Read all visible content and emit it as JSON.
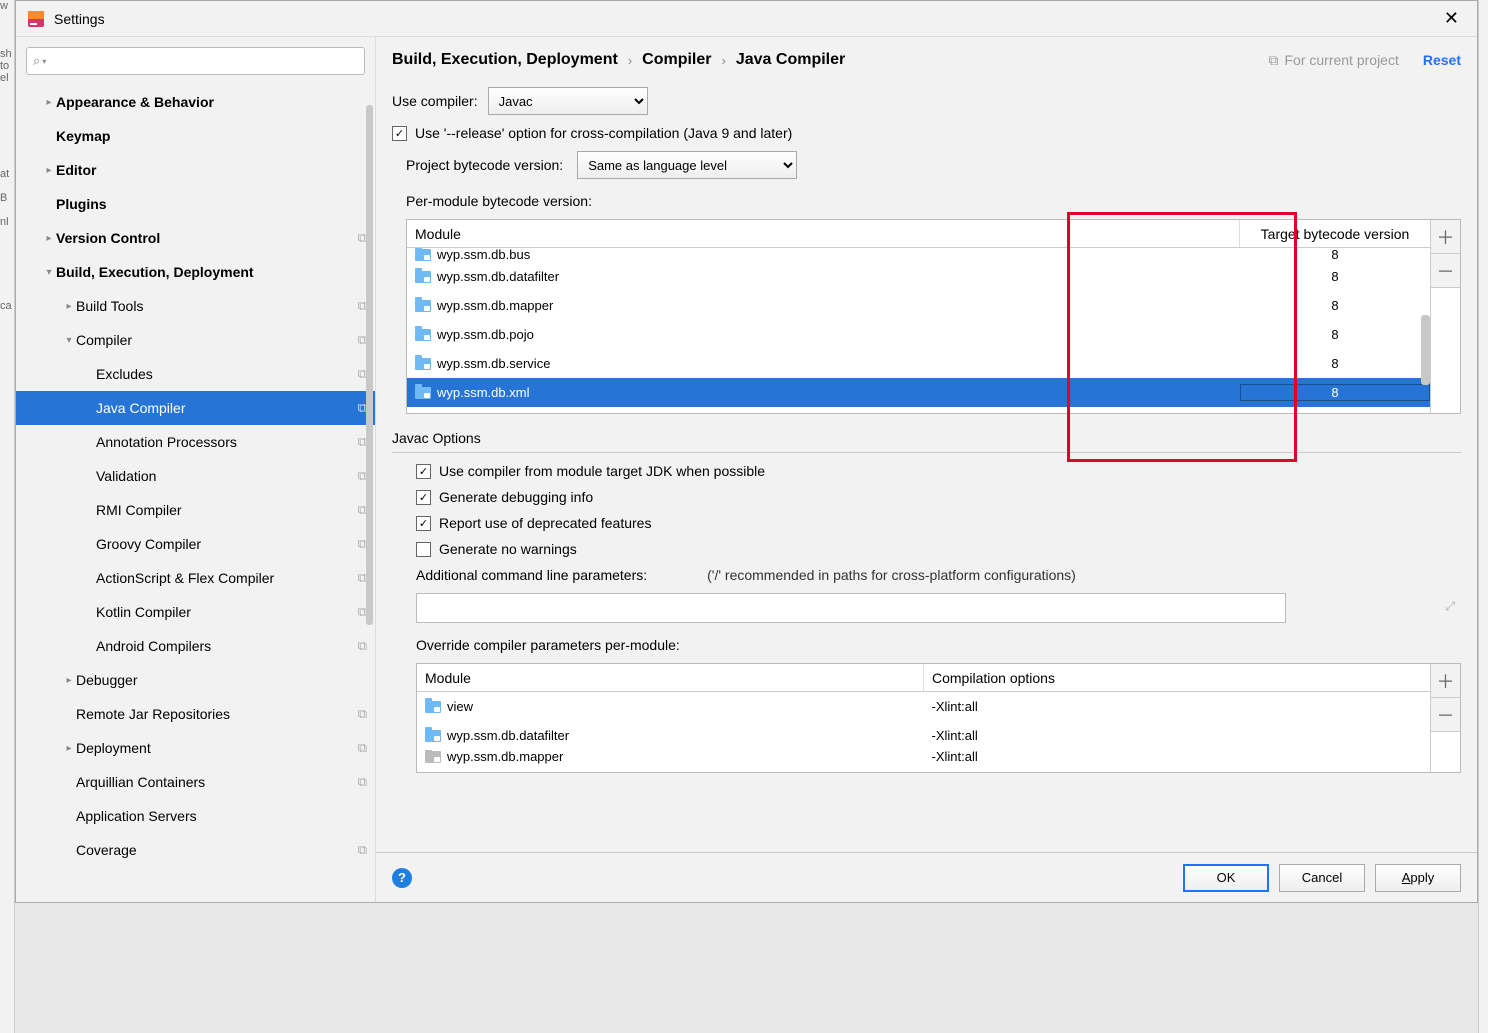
{
  "window": {
    "title": "Settings"
  },
  "sidebar": {
    "items": [
      {
        "label": "Appearance & Behavior",
        "arrow": "closed",
        "bold": true,
        "indent": 0
      },
      {
        "label": "Keymap",
        "arrow": "none",
        "bold": true,
        "indent": 0
      },
      {
        "label": "Editor",
        "arrow": "closed",
        "bold": true,
        "indent": 0
      },
      {
        "label": "Plugins",
        "arrow": "none",
        "bold": true,
        "indent": 0
      },
      {
        "label": "Version Control",
        "arrow": "closed",
        "bold": true,
        "indent": 0,
        "badge": true
      },
      {
        "label": "Build, Execution, Deployment",
        "arrow": "open",
        "bold": true,
        "indent": 0
      },
      {
        "label": "Build Tools",
        "arrow": "closed",
        "bold": false,
        "indent": 1,
        "badge": true
      },
      {
        "label": "Compiler",
        "arrow": "open",
        "bold": false,
        "indent": 1,
        "badge": true
      },
      {
        "label": "Excludes",
        "arrow": "none",
        "bold": false,
        "indent": 2,
        "badge": true
      },
      {
        "label": "Java Compiler",
        "arrow": "none",
        "bold": false,
        "indent": 2,
        "badge": true,
        "selected": true
      },
      {
        "label": "Annotation Processors",
        "arrow": "none",
        "bold": false,
        "indent": 2,
        "badge": true
      },
      {
        "label": "Validation",
        "arrow": "none",
        "bold": false,
        "indent": 2,
        "badge": true
      },
      {
        "label": "RMI Compiler",
        "arrow": "none",
        "bold": false,
        "indent": 2,
        "badge": true
      },
      {
        "label": "Groovy Compiler",
        "arrow": "none",
        "bold": false,
        "indent": 2,
        "badge": true
      },
      {
        "label": "ActionScript & Flex Compiler",
        "arrow": "none",
        "bold": false,
        "indent": 2,
        "badge": true
      },
      {
        "label": "Kotlin Compiler",
        "arrow": "none",
        "bold": false,
        "indent": 2,
        "badge": true
      },
      {
        "label": "Android Compilers",
        "arrow": "none",
        "bold": false,
        "indent": 2,
        "badge": true
      },
      {
        "label": "Debugger",
        "arrow": "closed",
        "bold": false,
        "indent": 1
      },
      {
        "label": "Remote Jar Repositories",
        "arrow": "none",
        "bold": false,
        "indent": 1,
        "badge": true
      },
      {
        "label": "Deployment",
        "arrow": "closed",
        "bold": false,
        "indent": 1,
        "badge": true
      },
      {
        "label": "Arquillian Containers",
        "arrow": "none",
        "bold": false,
        "indent": 1,
        "badge": true
      },
      {
        "label": "Application Servers",
        "arrow": "none",
        "bold": false,
        "indent": 1
      },
      {
        "label": "Coverage",
        "arrow": "none",
        "bold": false,
        "indent": 1,
        "badge": true
      }
    ]
  },
  "breadcrumb": [
    "Build, Execution, Deployment",
    "Compiler",
    "Java Compiler"
  ],
  "header": {
    "forProject": "For current project",
    "reset": "Reset"
  },
  "main": {
    "useCompilerLabel": "Use compiler:",
    "useCompilerValue": "Javac",
    "releaseOption": "Use '--release' option for cross-compilation (Java 9 and later)",
    "projectBytecodeLabel": "Project bytecode version:",
    "projectBytecodeValue": "Same as language level",
    "perModuleLabel": "Per-module bytecode version:",
    "moduleHeader": "Module",
    "targetHeader": "Target bytecode version",
    "modules": [
      {
        "name": "wyp.ssm.db.bus",
        "ver": "8",
        "cutoff": true
      },
      {
        "name": "wyp.ssm.db.datafilter",
        "ver": "8"
      },
      {
        "name": "wyp.ssm.db.mapper",
        "ver": "8"
      },
      {
        "name": "wyp.ssm.db.pojo",
        "ver": "8"
      },
      {
        "name": "wyp.ssm.db.service",
        "ver": "8"
      },
      {
        "name": "wyp.ssm.db.xml",
        "ver": "8",
        "selected": true
      }
    ],
    "javacOptionsTitle": "Javac Options",
    "opt1": "Use compiler from module target JDK when possible",
    "opt2": "Generate debugging info",
    "opt3": "Report use of deprecated features",
    "opt4": "Generate no warnings",
    "addlLabel": "Additional command line parameters:",
    "addlHint": "('/' recommended in paths for cross-platform configurations)",
    "overrideLabel": "Override compiler parameters per-module:",
    "overrideHeaderModule": "Module",
    "overrideHeaderOptions": "Compilation options",
    "overrides": [
      {
        "module": "view",
        "opts": "-Xlint:all"
      },
      {
        "module": "wyp.ssm.db.datafilter",
        "opts": "-Xlint:all"
      },
      {
        "module": "wyp.ssm.db.mapper",
        "opts": "-Xlint:all",
        "cutoff": true,
        "grey": true
      }
    ]
  },
  "footer": {
    "ok": "OK",
    "cancel": "Cancel",
    "apply": "pply"
  }
}
